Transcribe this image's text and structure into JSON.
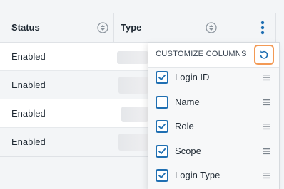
{
  "table": {
    "columns": [
      {
        "label": "Status",
        "sort_icon": "sort-up-down-icon"
      },
      {
        "label": "Type",
        "sort_icon": "sort-up-down-icon"
      }
    ],
    "menu_icon": "kebab-vertical-icon",
    "rows": [
      {
        "status": "Enabled"
      },
      {
        "status": "Enabled"
      },
      {
        "status": "Enabled"
      },
      {
        "status": "Enabled"
      }
    ]
  },
  "column_menu": {
    "title": "CUSTOMIZE COLUMNS",
    "reset_icon": "reset-icon",
    "accent_color": "#1f6fb2",
    "highlight_color": "#f39a55",
    "options": [
      {
        "label": "Login ID",
        "checked": true
      },
      {
        "label": "Name",
        "checked": false
      },
      {
        "label": "Role",
        "checked": true
      },
      {
        "label": "Scope",
        "checked": true
      },
      {
        "label": "Login Type",
        "checked": true
      }
    ]
  }
}
